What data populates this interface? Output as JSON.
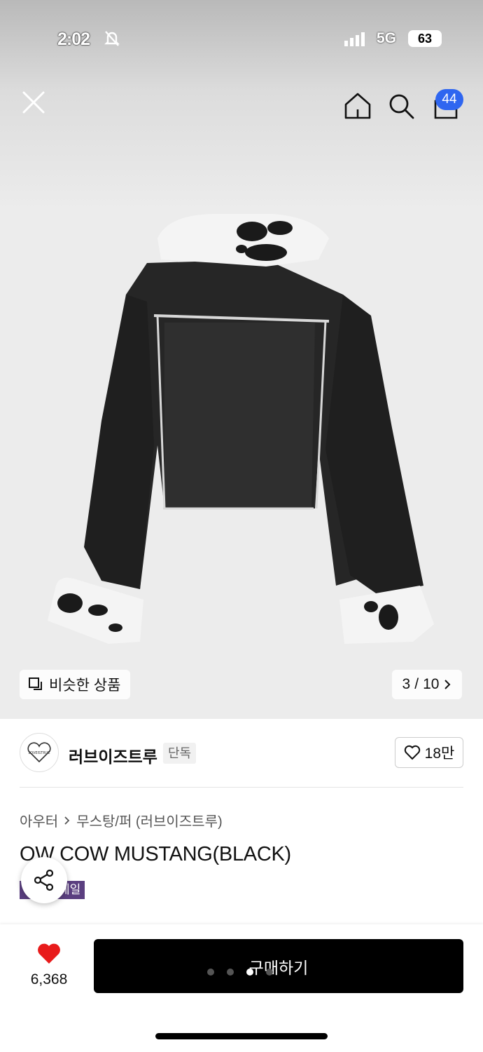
{
  "status": {
    "time": "2:02",
    "network": "5G",
    "battery": "63"
  },
  "nav": {
    "cart_count": "44"
  },
  "gallery": {
    "similar_label": "비슷한 상품",
    "current": "3",
    "total": "10",
    "separator": "/"
  },
  "brand": {
    "name": "러브이즈트루",
    "tag": "단독",
    "like_count": "18만",
    "logo_text": "LOVEISTRUE"
  },
  "product": {
    "breadcrumb": [
      "아우터",
      "무스탕/퍼 (러브이즈트루)"
    ],
    "title": "OW COW MUSTANG(BLACK)",
    "badge": "세일"
  },
  "bottom": {
    "likes": "6,368",
    "buy_label": "구매하기"
  },
  "colors": {
    "accent": "#2f66f0",
    "heart": "#e81b1b",
    "badge": "#5b3f80",
    "buy": "#000000"
  }
}
